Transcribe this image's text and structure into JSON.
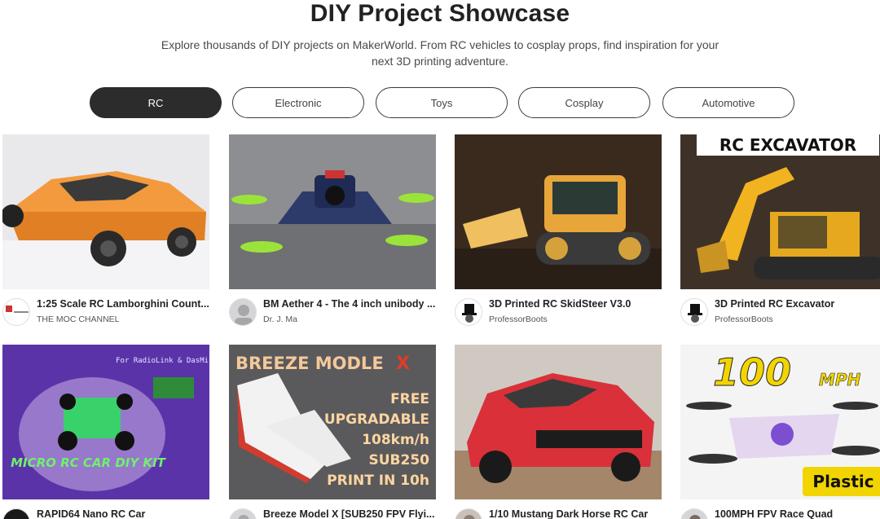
{
  "header": {
    "title": "DIY Project Showcase",
    "subtitle": "Explore thousands of DIY projects on MakerWorld. From RC vehicles to cosplay props, find inspiration for your next 3D printing adventure."
  },
  "filters": [
    {
      "label": "RC",
      "active": true
    },
    {
      "label": "Electronic",
      "active": false
    },
    {
      "label": "Toys",
      "active": false
    },
    {
      "label": "Cosplay",
      "active": false
    },
    {
      "label": "Automotive",
      "active": false
    }
  ],
  "cards": [
    {
      "title": "1:25 Scale RC Lamborghini Count...",
      "author": "THE MOC CHANNEL",
      "image_text": "",
      "avatar_text": "THE MOC CHANNEL"
    },
    {
      "title": "BM Aether 4 - The 4 inch unibody ...",
      "author": "Dr. J. Ma",
      "image_text": ""
    },
    {
      "title": "3D Printed RC SkidSteer V3.0",
      "author": "ProfessorBoots",
      "image_text": "",
      "avatar_text": "PROF BOOTS"
    },
    {
      "title": "3D Printed RC Excavator",
      "author": "ProfessorBoots",
      "image_text": "RC  EXCAVATOR",
      "avatar_text": "PROF BOOTS"
    },
    {
      "title": "RAPID64 Nano RC Car",
      "author": "",
      "image_text": "MICRO RC CAR DIY KIT",
      "image_note": "For RadioLink & DasMirko ESC",
      "avatar_text": "RAPID"
    },
    {
      "title": "Breeze Model X [SUB250 FPV Flyi...",
      "author": "",
      "image_title": "BREEZE MODLE",
      "image_title_accent": "X",
      "image_lines": [
        "FREE",
        "UPGRADABLE",
        "108km/h",
        "SUB250",
        "PRINT IN 10h"
      ]
    },
    {
      "title": "1/10 Mustang Dark Horse RC Car",
      "author": "",
      "image_text": ""
    },
    {
      "title": "100MPH FPV Race Quad",
      "author": "",
      "image_big": "100",
      "image_unit": "MPH",
      "image_badge": "Plastic"
    }
  ],
  "colors": {
    "active_pill": "#2c2c2c",
    "pill_border": "#3a3a3a",
    "accent_orange": "#f08a2a",
    "accent_yellow": "#f2d500"
  }
}
